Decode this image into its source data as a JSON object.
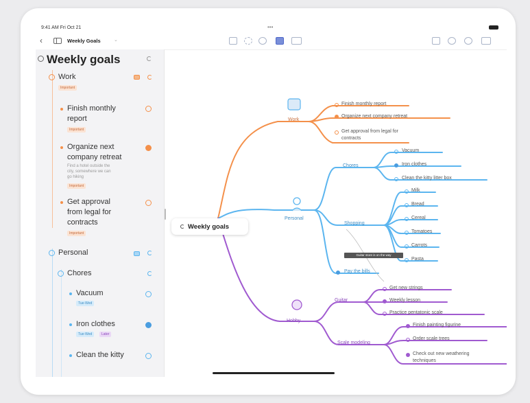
{
  "status_bar": {
    "time": "9:41 AM Fri Oct 21",
    "center": "•••"
  },
  "toolbar": {
    "back": "‹",
    "doc_title": "Weekly Goals",
    "doc_chevron": "⌄"
  },
  "sidebar": {
    "title": "Weekly goals",
    "work": {
      "label": "Work",
      "tag": "Important",
      "items": [
        {
          "label_lines": [
            "Finish monthly",
            "report"
          ],
          "tag": "Important"
        },
        {
          "label_lines": [
            "Organize next",
            "company retreat"
          ],
          "note_lines": [
            "Find a hotel outside the",
            "city, somewhere we can",
            "go hiking"
          ],
          "tag": "Important"
        },
        {
          "label_lines": [
            "Get approval",
            "from legal for",
            "contracts"
          ],
          "tag": "Important"
        }
      ]
    },
    "personal": {
      "label": "Personal",
      "chores": {
        "label": "Chores",
        "items": [
          {
            "label": "Vacuum",
            "tags": [
              "Tue-Wed"
            ]
          },
          {
            "label": "Iron clothes",
            "tags": [
              "Tue-Wed",
              "Later"
            ]
          },
          {
            "label": "Clean the kitty"
          }
        ]
      }
    }
  },
  "map": {
    "root": "Weekly goals",
    "tooltip": "Guitar store is on the way",
    "work": {
      "label": "Work",
      "items": [
        "Finish monthly report",
        "Organize next company retreat",
        "Get approval from legal for",
        "contracts"
      ]
    },
    "personal": {
      "label": "Personal",
      "chores": {
        "label": "Chores",
        "items": [
          "Vacuum",
          "Iron clothes",
          "Clean the kitty litter box"
        ]
      },
      "shopping": {
        "label": "Shopping",
        "items": [
          "Milk",
          "Bread",
          "Cereal",
          "Tomatoes",
          "Carrots",
          "Pasta"
        ]
      },
      "bills": "Pay the bills"
    },
    "hobby": {
      "label": "Hobby",
      "guitar": {
        "label": "Guitar",
        "items": [
          "Get new strings",
          "Weekly lesson",
          "Practice pentatonic scale"
        ]
      },
      "scale": {
        "label": "Scale modeling",
        "items": [
          "Finish painting figurine",
          "Order scale trees",
          "Check out new weathering",
          "techniques"
        ]
      }
    }
  },
  "colors": {
    "work": "#f4904a",
    "personal": "#5bb5ef",
    "hobby": "#a05ad0"
  }
}
